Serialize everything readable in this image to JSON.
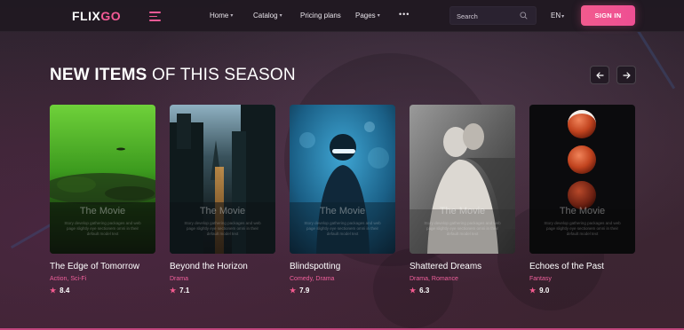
{
  "brand": {
    "logo_main": "FLIX",
    "logo_accent": "GO"
  },
  "header": {
    "nav": [
      {
        "label": "Home",
        "has_dropdown": true
      },
      {
        "label": "Catalog",
        "has_dropdown": true
      },
      {
        "label": "Pricing plans",
        "has_dropdown": false
      },
      {
        "label": "Pages",
        "has_dropdown": true
      }
    ],
    "more_label": "•••",
    "search_placeholder": "Search",
    "language": "EN",
    "signin_label": "SIGN IN"
  },
  "section": {
    "title_bold": "NEW ITEMS",
    "title_light": " OF THIS SEASON",
    "prev_icon": "arrow-left-icon",
    "next_icon": "arrow-right-icon"
  },
  "cards": [
    {
      "poster_title": "The Movie",
      "poster_blurb": "Story develop gathering packages and web page slightly eye sectionem omni in their default model text",
      "title": "The Edge of Tomorrow",
      "genres": "Action, Sci-Fi",
      "rating": "8.4"
    },
    {
      "poster_title": "The Movie",
      "poster_blurb": "Story develop gathering packages and web page slightly eye sectionem omni in their default model text",
      "title": "Beyond the Horizon",
      "genres": "Drama",
      "rating": "7.1"
    },
    {
      "poster_title": "The Movie",
      "poster_blurb": "Story develop gathering packages and web page slightly eye sectionem omni in their default model text",
      "title": "Blindspotting",
      "genres": "Comedy, Drama",
      "rating": "7.9"
    },
    {
      "poster_title": "The Movie",
      "poster_blurb": "Story develop gathering packages and web page slightly eye sectionem omni in their default model text",
      "title": "Shattered Dreams",
      "genres": "Drama, Romance",
      "rating": "6.3"
    },
    {
      "poster_title": "The Movie",
      "poster_blurb": "Story develop gathering packages and web page slightly eye sectionem omni in their default model text",
      "title": "Echoes of the Past",
      "genres": "Fantasy",
      "rating": "9.0"
    }
  ],
  "colors": {
    "accent": "#f25a8e",
    "genre": "#f0609c",
    "header_bg": "#201921",
    "page_bg": "#2b2130"
  }
}
